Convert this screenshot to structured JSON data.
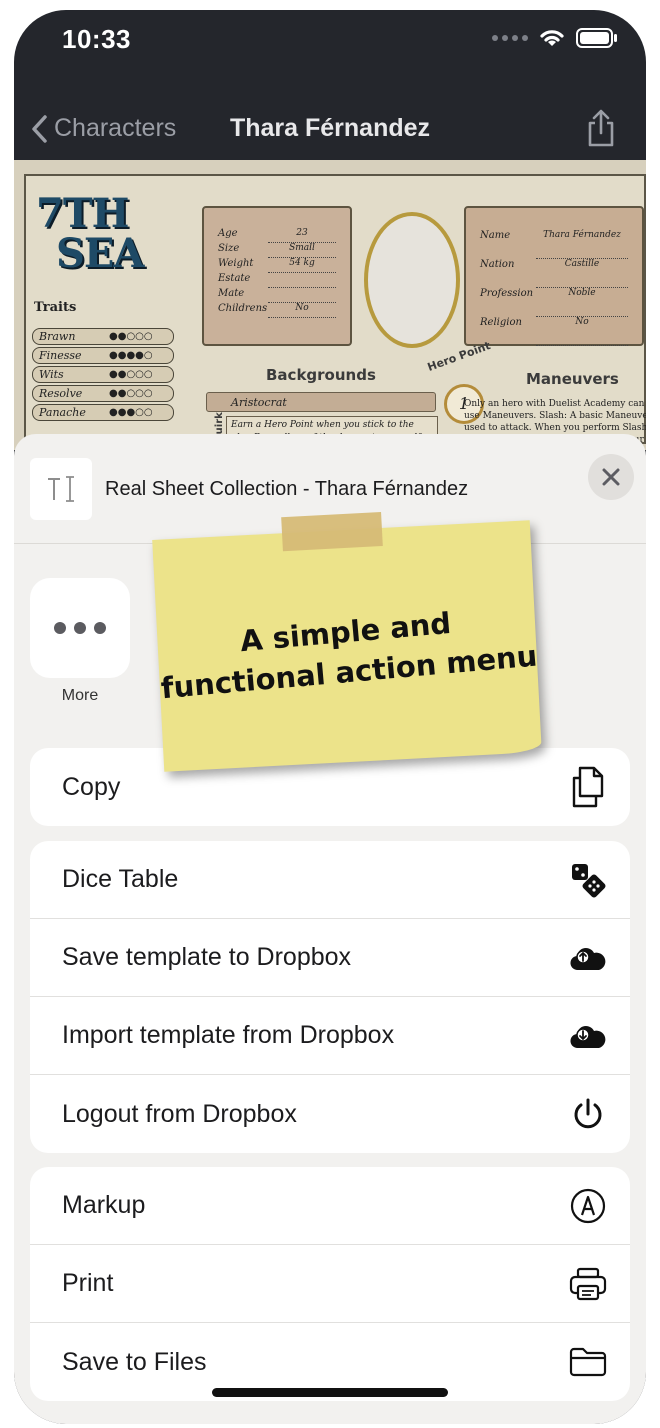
{
  "status_bar": {
    "time": "10:33"
  },
  "nav": {
    "back_label": "Characters",
    "title": "Thara Férnandez"
  },
  "character_sheet": {
    "logo_line1": "7TH",
    "logo_line2": "SEA",
    "traits_label": "Traits",
    "traits": [
      {
        "name": "Brawn",
        "dots": "●●○○○"
      },
      {
        "name": "Finesse",
        "dots": "●●●●○"
      },
      {
        "name": "Wits",
        "dots": "●●○○○"
      },
      {
        "name": "Resolve",
        "dots": "●●○○○"
      },
      {
        "name": "Panache",
        "dots": "●●●○○"
      }
    ],
    "personal": [
      {
        "label": "Age",
        "value": "23"
      },
      {
        "label": "Size",
        "value": "Small"
      },
      {
        "label": "Weight",
        "value": "54 kg"
      },
      {
        "label": "Estate",
        "value": ""
      },
      {
        "label": "Mate",
        "value": ""
      },
      {
        "label": "Childrens",
        "value": "No"
      }
    ],
    "identity": [
      {
        "label": "Name",
        "value": "Thara Férnandez"
      },
      {
        "label": "Nation",
        "value": "Castille"
      },
      {
        "label": "Profession",
        "value": "Noble"
      },
      {
        "label": "Religion",
        "value": "No"
      }
    ],
    "backgrounds_heading": "Backgrounds",
    "background_value": "Aristocrat",
    "quirk_label": "Quirk",
    "quirk_text": "Earn a Hero Point when you stick to the plan Regardless of the danger to yourself",
    "hero_point_label": "Hero Point",
    "hero_point_value": "1",
    "maneuvers_heading": "Maneuvers",
    "maneuver_text": "Only an hero with Duelist Academy can use Maneuvers. Slash: A basic Maneuver used to attack. When you perform Slash, deal a number of Wounds equal to your Ranks in Weaponry."
  },
  "action_sheet": {
    "document_title": "Real Sheet Collection - Thara Férnandez",
    "more_label": "More",
    "groups": [
      [
        {
          "label": "Copy",
          "icon": "copy-icon"
        }
      ],
      [
        {
          "label": "Dice Table",
          "icon": "dice-icon"
        },
        {
          "label": "Save template to Dropbox",
          "icon": "cloud-upload-icon"
        },
        {
          "label": "Import template from Dropbox",
          "icon": "cloud-download-icon"
        },
        {
          "label": "Logout from Dropbox",
          "icon": "power-icon"
        }
      ],
      [
        {
          "label": "Markup",
          "icon": "markup-icon"
        },
        {
          "label": "Print",
          "icon": "printer-icon"
        },
        {
          "label": "Save to Files",
          "icon": "folder-icon"
        }
      ]
    ]
  },
  "sticky_note": {
    "line1": "A simple and",
    "line2": "functional action menu"
  }
}
